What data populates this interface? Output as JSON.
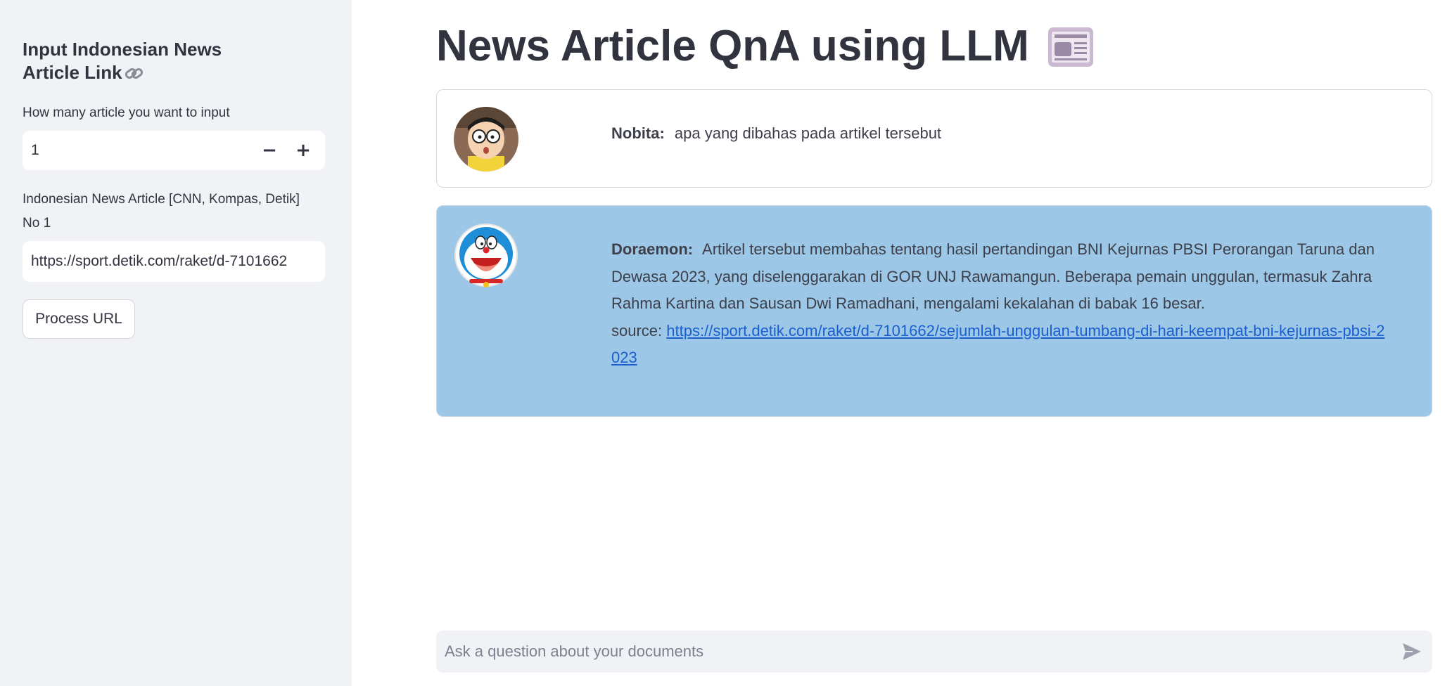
{
  "sidebar": {
    "title": "Input Indonesian News Article Link",
    "link_icon": "link-icon",
    "count_label": "How many article you want to input",
    "count_value": "1",
    "decrement_label": "−",
    "increment_label": "+",
    "article_label": "Indonesian News Article [CNN, Kompas, Detik]",
    "article_sublabel": "No 1",
    "article_url": "https://sport.detik.com/raket/d-7101662",
    "process_button": "Process URL"
  },
  "main": {
    "title": "News Article QnA using LLM",
    "title_icon": "newspaper-icon",
    "messages": [
      {
        "speaker": "Nobita:",
        "avatar": "nobita-avatar",
        "text": "apa yang dibahas pada artikel tersebut"
      },
      {
        "speaker": "Doraemon:",
        "avatar": "doraemon-avatar",
        "text": "Artikel tersebut membahas tentang hasil pertandingan BNI Kejurnas PBSI Perorangan Taruna dan Dewasa 2023, yang diselenggarakan di GOR UNJ Rawamangun. Beberapa pemain unggulan, termasuk Zahra Rahma Kartina dan Sausan Dwi Ramadhani, mengalami kekalahan di babak 16 besar.",
        "source_label": "source:",
        "source_url": "https://sport.detik.com/raket/d-7101662/sejumlah-unggulan-tumbang-di-hari-keempat-bni-kejurnas-pbsi-2023"
      }
    ],
    "chat_placeholder": "Ask a question about your documents",
    "send_icon": "send-icon"
  },
  "colors": {
    "sidebar_bg": "#f0f2f6",
    "bot_bubble": "#9dc7e6",
    "link": "#1a5fd0",
    "text": "#31333f"
  }
}
